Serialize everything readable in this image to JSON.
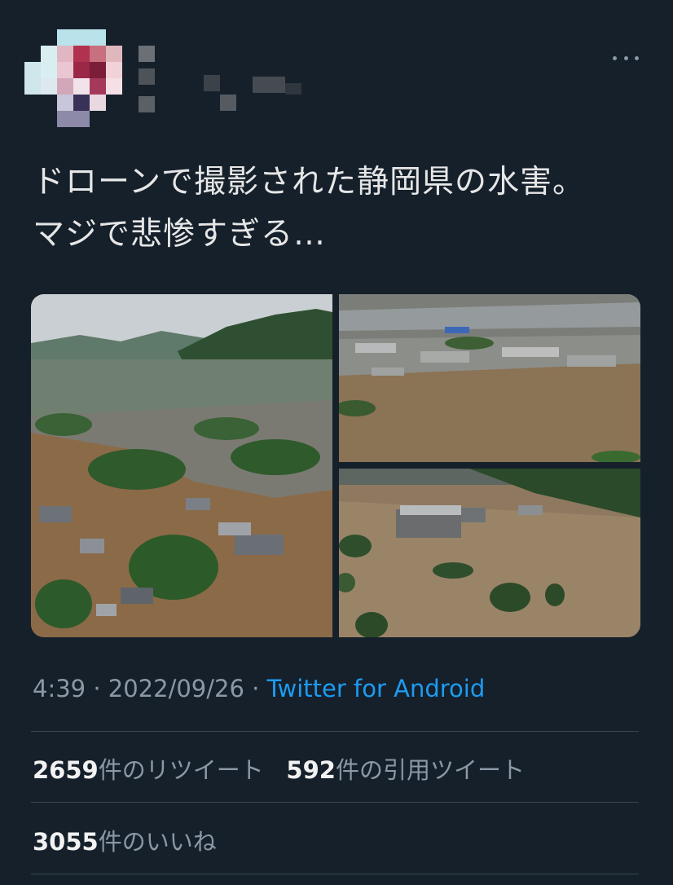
{
  "tweet": {
    "text_line1": "ドローンで撮影された静岡県の水害。",
    "text_line2": "マジで悲惨すぎる…",
    "time": "4:39",
    "separator": "·",
    "date": "2022/09/26",
    "source": "Twitter for Android"
  },
  "stats": {
    "retweets_count": "2659",
    "retweets_label": "件のリツイート",
    "quotes_count": "592",
    "quotes_label": "件の引用ツイート",
    "likes_count": "3055",
    "likes_label": "件のいいね"
  },
  "icons": {
    "more": "more-horizontal-icon"
  },
  "colors": {
    "background": "#15202b",
    "link": "#1d9bf0",
    "muted": "#8b98a5",
    "divider": "#38444d"
  }
}
